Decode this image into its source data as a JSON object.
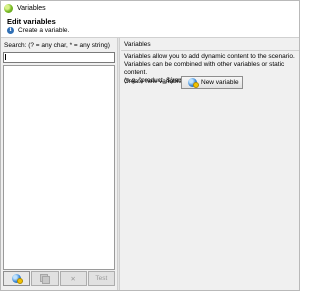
{
  "window": {
    "title": "Variables"
  },
  "header": {
    "title": "Edit variables",
    "message": "Create a variable."
  },
  "left_panel": {
    "search_label": "Search: (? = any char, * = any string)",
    "search_value": "",
    "toolbar": {
      "delete_label": "✕",
      "test_label": "Test"
    }
  },
  "right_panel": {
    "heading": "Variables",
    "description_lines": [
      "Variables allow you to add dynamic content to the scenario.",
      "Variables can be combined with other variables or static content.",
      "(e.g. \"product_${random(ID)}\")"
    ],
    "create_label": "Create new variable",
    "new_variable_button": "New variable"
  },
  "colors": {
    "panel_bg": "#f0f0f0",
    "window_bg": "#ffffff",
    "info_icon": "#2f6fb5"
  }
}
